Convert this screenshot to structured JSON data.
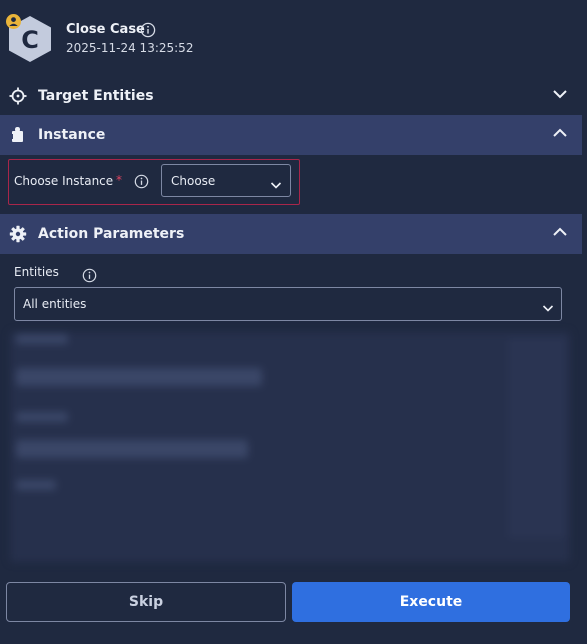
{
  "header": {
    "icon_letter": "C",
    "title": "Close Case",
    "timestamp": "2025-11-24 13:25:52"
  },
  "sections": {
    "target_entities": {
      "label": "Target Entities",
      "icon": "crosshair-icon",
      "expanded": false
    },
    "instance": {
      "label": "Instance",
      "icon": "puzzle-icon",
      "expanded": true
    },
    "action_parameters": {
      "label": "Action Parameters",
      "icon": "gear-icon",
      "expanded": true
    }
  },
  "instance_field": {
    "label": "Choose Instance",
    "required_mark": "*",
    "value": "Choose"
  },
  "entities_field": {
    "label": "Entities",
    "value": "All entities"
  },
  "buttons": {
    "skip": "Skip",
    "execute": "Execute"
  },
  "colors": {
    "background": "#1f2940",
    "section_header": "#34406a",
    "primary": "#2f6fe0",
    "error_outline": "#a8264a",
    "avatar": "#e9b43a"
  }
}
